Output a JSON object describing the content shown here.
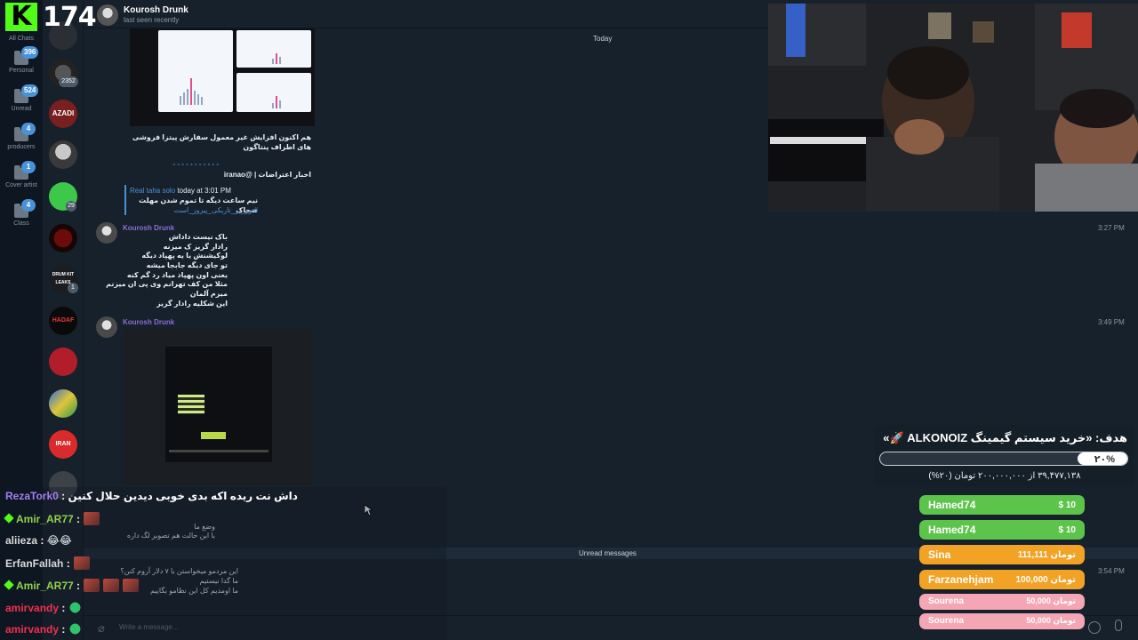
{
  "stream": {
    "viewer_count": "174"
  },
  "folders": [
    {
      "label": "All Chats",
      "badge": ""
    },
    {
      "label": "Personal",
      "badge": "396"
    },
    {
      "label": "Unread",
      "badge": "524"
    },
    {
      "label": "producers",
      "badge": "4"
    },
    {
      "label": "Cover artist",
      "badge": "1"
    },
    {
      "label": "Class",
      "badge": "4"
    }
  ],
  "chat_list": {
    "avatars": [
      {
        "name": "avatar-chat-1",
        "badge": ""
      },
      {
        "name": "avatar-chat-2",
        "badge": "2352",
        "text": ""
      },
      {
        "name": "avatar-azadi",
        "badge": "",
        "text": "AZADI"
      },
      {
        "name": "avatar-chat-4",
        "badge": "",
        "text": ""
      },
      {
        "name": "avatar-chat-5",
        "badge": "29",
        "text": ""
      },
      {
        "name": "avatar-chat-6",
        "badge": "",
        "text": ""
      },
      {
        "name": "avatar-drum-kit",
        "badge": "1",
        "text": "DRUM KIT LEAKS"
      },
      {
        "name": "avatar-hadaf",
        "badge": "",
        "text": "HADAF"
      },
      {
        "name": "avatar-chat-9",
        "badge": "",
        "text": ""
      },
      {
        "name": "avatar-chat-10",
        "badge": "",
        "text": ""
      },
      {
        "name": "avatar-iran",
        "badge": "",
        "text": "IRAN"
      },
      {
        "name": "avatar-chat-12",
        "badge": "",
        "text": ""
      }
    ]
  },
  "header": {
    "contact_name": "Kourosh Drunk",
    "status": "last seen recently"
  },
  "conversation": {
    "date_separator": "Today",
    "forwarded_caption": "هم اکنون افزایش غیر معمول سفارش پیتزا فروشی های اطراف پنتاگون",
    "divider": "- - - - - - - - - - -",
    "source_line": "اخبار اعتراضات | @iranao",
    "reply_author": "Real taha solo",
    "reply_time": "today at 3:01 PM",
    "reply_text": "نیم ساعت دیگه تا تموم شدن مهلت ضحاک",
    "reply_hashtag": "#نور_بر_تاریکی_پیروز_است",
    "messages": [
      {
        "sender": "Kourosh Drunk",
        "time": "3:27 PM",
        "lines": [
          "باک نیست داداش",
          "رادار گریز ک میزنه",
          "لوکیشنش یا یه پهپاد دیگه",
          "تو جای دیگه جابجا میشه",
          "یعنی اون پهپاد میاد رد گم کنه",
          "مثلا من کف تهرانم وی پی ان میزنم",
          "میرم آلمان",
          "این شکلیه رادار گریز"
        ]
      },
      {
        "sender": "Kourosh Drunk",
        "time": "3:49 PM",
        "lines": [
          "وضع ما",
          "با این حالت هم تصویر لگ داره"
        ]
      },
      {
        "sender": "",
        "time": "3:54 PM",
        "lines": [
          "این مردمو میخواستن با ۷ دلار آروم کنن؟",
          "ما گدا نیستیم",
          "ما اومدیم کل این نظامو بگاییم"
        ]
      }
    ],
    "unread_label": "Unread messages"
  },
  "composer": {
    "placeholder": "Write a message..."
  },
  "stream_chat": [
    {
      "user": "RezaTork0",
      "message": "داش نت ریده اکه بدی خوبی دیدین حلال کنین",
      "color": "#a37ff2",
      "badge": false,
      "emotes": 0
    },
    {
      "user": "Amir_AR77",
      "message": "",
      "color": "#8fd14f",
      "badge": true,
      "emotes": 1
    },
    {
      "user": "aliieza",
      "message": "😂😂",
      "color": "#d8d8d8",
      "badge": false,
      "emotes": 0
    },
    {
      "user": "ErfanFallah",
      "message": "",
      "color": "#d8d8d8",
      "badge": false,
      "emotes": 1
    },
    {
      "user": "Amir_AR77",
      "message": "",
      "color": "#8fd14f",
      "badge": true,
      "emotes": 3
    },
    {
      "user": "amirvandy",
      "message": "",
      "color": "#f0304f",
      "badge": false,
      "emotes": 0
    },
    {
      "user": "amirvandy",
      "message": "",
      "color": "#f0304f",
      "badge": false,
      "emotes": 0
    }
  ],
  "donation_goal": {
    "title": "هدف: «خرید سیستم گیمینگ ALKONOIZ 🚀»",
    "progress_percent": 20,
    "progress_label": "۲۰%",
    "subtitle": "۳۹,۴۷۷,۱۳۸ از ۲۰۰,۰۰۰,۰۰۰ تومان (۲۰%)"
  },
  "donors": [
    {
      "name": "Hamed74",
      "amount": "$ 10",
      "color": "#5cc44a"
    },
    {
      "name": "Hamed74",
      "amount": "$ 10",
      "color": "#5cc44a"
    },
    {
      "name": "Sina",
      "amount": "111,111 تومان",
      "color": "#f2a224"
    },
    {
      "name": "Farzanehjam",
      "amount": "100,000 تومان",
      "color": "#f2a224"
    },
    {
      "name": "Sourena",
      "amount": "50,000 تومان",
      "color": "#f4a6b4"
    },
    {
      "name": "Sourena",
      "amount": "50,000 تومان",
      "color": "#f4a6b4"
    }
  ]
}
